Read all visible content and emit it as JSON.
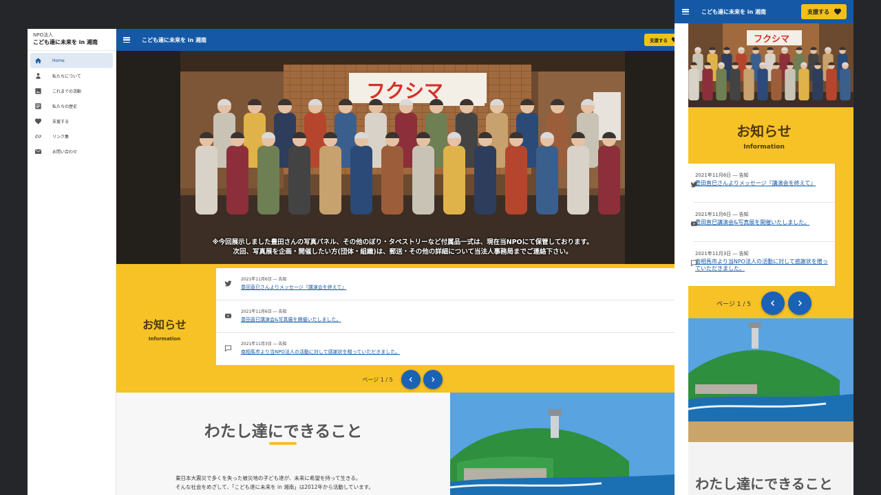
{
  "site": {
    "org_type": "NPO法人",
    "name": "こども達に未来を in 湘南",
    "support_label": "支援する"
  },
  "sidebar": {
    "items": [
      {
        "label": "Home",
        "icon": "home-icon",
        "active": true
      },
      {
        "label": "私たちについて",
        "icon": "about-icon"
      },
      {
        "label": "これまでの活動",
        "icon": "image-icon"
      },
      {
        "label": "私たちの歴史",
        "icon": "history-icon"
      },
      {
        "label": "支援する",
        "icon": "heart-icon"
      },
      {
        "label": "リンク集",
        "icon": "link-icon"
      },
      {
        "label": "お問い合わせ",
        "icon": "mail-icon"
      }
    ]
  },
  "hero": {
    "banner_text": "フクシマ",
    "caption_line1": "※今回展示しました豊田さんの写真パネル、その他のぼり・タペストリーなど付属品一式は、現在当NPOにて保管しております。",
    "caption_line2": "次回、写真展を企画・開催したい方(団体・組織)は、郵送・その他の詳細について当法人事務局までご連絡下さい。"
  },
  "news": {
    "title": "お知らせ",
    "subtitle": "Information",
    "items": [
      {
        "icon": "twitter-icon",
        "meta": "2021年11月6日 ― 告知",
        "title": "豊田直巳さんよりメッセージ『講演会を終えて』"
      },
      {
        "icon": "youtube-icon",
        "meta": "2021年11月6日 ― 告知",
        "title": "豊田直巳講演会&写真展を開催いたしました。"
      },
      {
        "icon": "comment-icon",
        "meta": "2021年11月3日 ― 告知",
        "title": "南相馬市より当NPO法人の活動に対して感謝状を贈っていただきました。"
      }
    ],
    "pager_label": "ページ 1 / 5"
  },
  "what": {
    "title": "わたし達にできること",
    "body_line1": "東日本大震災で多くを失った被災地の子ども達が、未来に希望を持って生きる。",
    "body_line2": "そんな社会をめざして、「こども達に未来を in 湘南」は2012年から活動しています。"
  },
  "colors": {
    "primary": "#1559a6",
    "accent": "#f6c226",
    "background": "#24262a"
  }
}
